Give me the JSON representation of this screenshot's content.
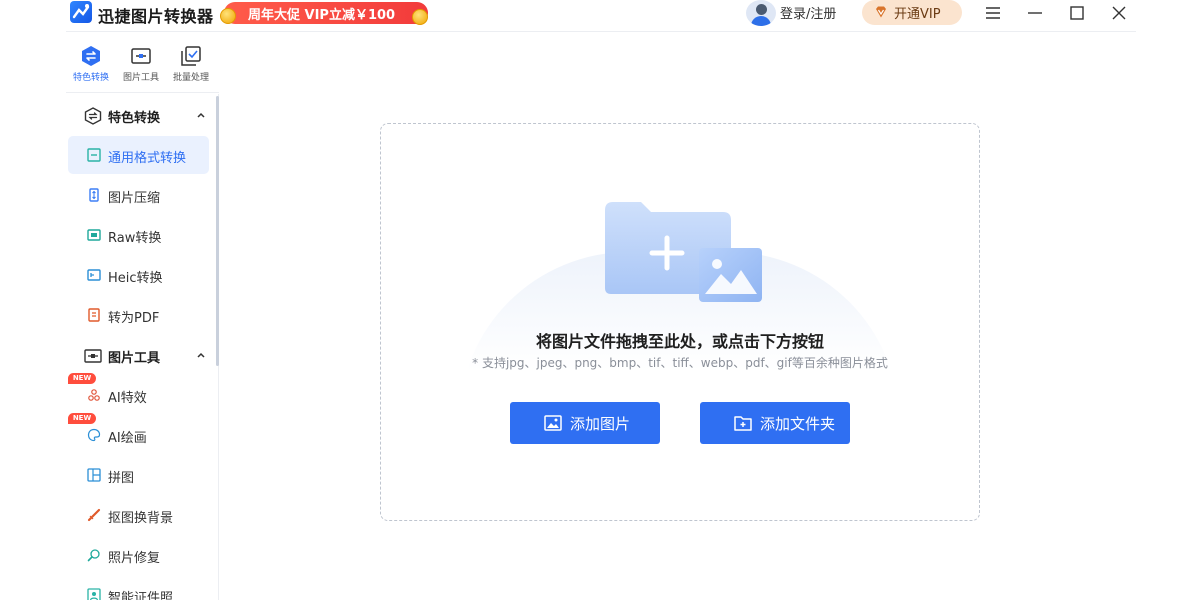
{
  "app": {
    "title": "迅捷图片转换器",
    "promo": "周年大促 VIP立减￥100",
    "login": "登录/注册",
    "vip": "开通VIP",
    "accent": "#2f6ff2"
  },
  "tabs": [
    {
      "label": "特色转换",
      "icon": "exchange-icon",
      "active": true
    },
    {
      "label": "图片工具",
      "icon": "image-tool-icon",
      "active": false
    },
    {
      "label": "批量处理",
      "icon": "batch-icon",
      "active": false
    }
  ],
  "sidebar": {
    "group1": {
      "label": "特色转换",
      "icon": "exchange-icon"
    },
    "group1_items": [
      {
        "label": "通用格式转换",
        "icon": "format-icon",
        "active": true
      },
      {
        "label": "图片压缩",
        "icon": "compress-icon"
      },
      {
        "label": "Raw转换",
        "icon": "raw-icon"
      },
      {
        "label": "Heic转换",
        "icon": "heic-icon"
      },
      {
        "label": "转为PDF",
        "icon": "pdf-icon"
      }
    ],
    "group2": {
      "label": "图片工具",
      "icon": "image-tool-icon"
    },
    "group2_items": [
      {
        "label": "AI特效",
        "icon": "ai-effect-icon",
        "badge": "NEW"
      },
      {
        "label": "AI绘画",
        "icon": "ai-paint-icon",
        "badge": "NEW"
      },
      {
        "label": "拼图",
        "icon": "collage-icon"
      },
      {
        "label": "抠图换背景",
        "icon": "cutout-icon"
      },
      {
        "label": "照片修复",
        "icon": "repair-icon"
      },
      {
        "label": "智能证件照",
        "icon": "id-photo-icon"
      }
    ]
  },
  "main": {
    "drop_title": "将图片文件拖拽至此处，或点击下方按钮",
    "drop_hint": "* 支持jpg、jpeg、png、bmp、tif、tiff、webp、pdf、gif等百余种图片格式",
    "add_image": "添加图片",
    "add_folder": "添加文件夹"
  }
}
